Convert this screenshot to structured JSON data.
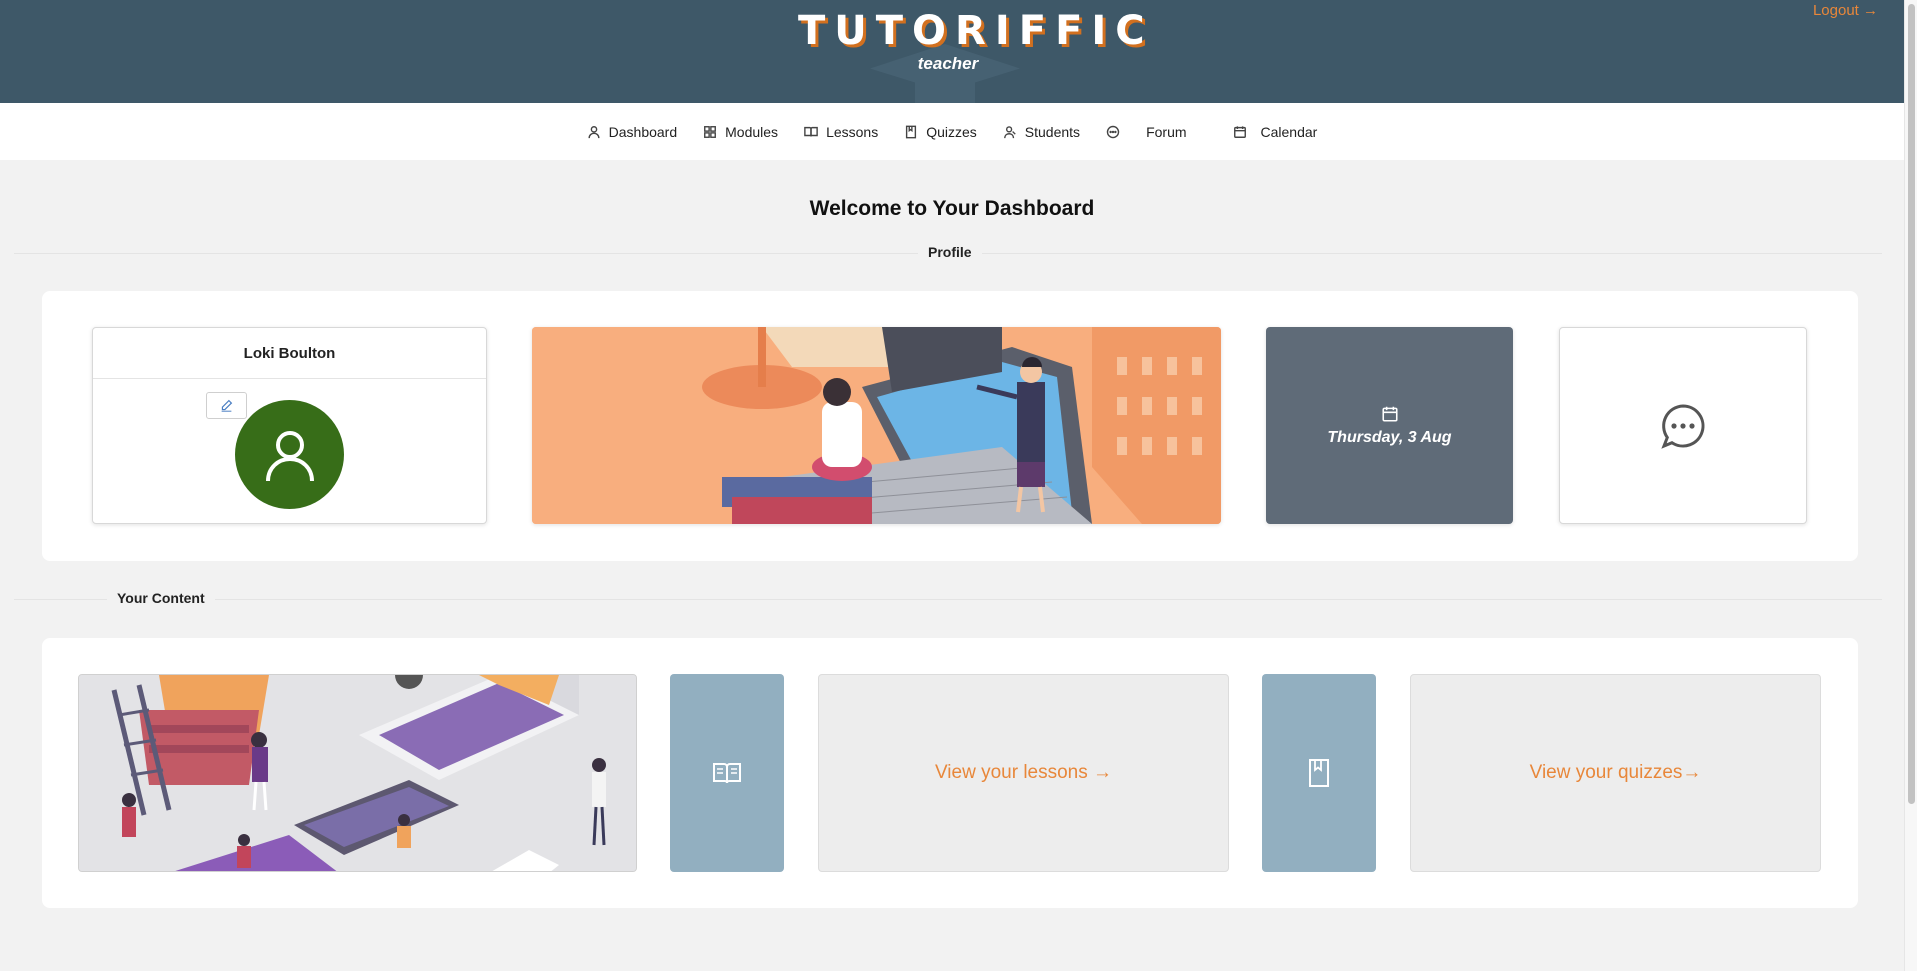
{
  "header": {
    "logo_title": "TUTORIFFIC",
    "logo_subtitle": "teacher",
    "logout_label": "Logout →",
    "brand_color": "#e8873a",
    "header_color": "#3e5868"
  },
  "nav": {
    "items": [
      {
        "label": "Dashboard",
        "icon": "user-icon"
      },
      {
        "label": "Modules",
        "icon": "grid-icon"
      },
      {
        "label": "Lessons",
        "icon": "book-open-icon"
      },
      {
        "label": "Quizzes",
        "icon": "bookmark-icon"
      },
      {
        "label": "Students",
        "icon": "users-icon"
      },
      {
        "label": "Forum",
        "icon": "chat-icon"
      },
      {
        "label": "Calendar",
        "icon": "calendar-icon"
      }
    ]
  },
  "main": {
    "welcome": "Welcome to Your Dashboard",
    "profile_section": "Profile",
    "content_section": "Your Content"
  },
  "profile": {
    "name": "Loki Boulton",
    "avatar_color": "#376d18",
    "date": "Thursday, 3 Aug"
  },
  "content": {
    "lessons_link": "View your lessons →",
    "quizzes_link": "View your quizzes→"
  }
}
